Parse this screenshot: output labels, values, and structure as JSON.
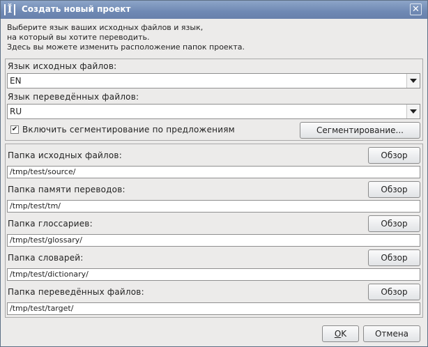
{
  "window": {
    "title": "Создать новый проект",
    "close_label": "✕"
  },
  "intro": {
    "lines": [
      "Выберите язык ваших исходных файлов и язык,",
      "на который вы хотите переводить.",
      "Здесь вы можете изменить расположение папок проекта."
    ]
  },
  "languages": {
    "source_label": "Язык исходных файлов:",
    "source_value": "EN",
    "target_label": "Язык переведённых файлов:",
    "target_value": "RU",
    "segmentation_checkbox_label": "Включить сегментирование по предложениям",
    "segmentation_checked": true,
    "segmentation_button": "Сегментирование..."
  },
  "folders": {
    "browse_label": "Обзор",
    "items": [
      {
        "label": "Папка исходных файлов:",
        "path": "/tmp/test/source/"
      },
      {
        "label": "Папка памяти переводов:",
        "path": "/tmp/test/tm/"
      },
      {
        "label": "Папка глоссариев:",
        "path": "/tmp/test/glossary/"
      },
      {
        "label": "Папка словарей:",
        "path": "/tmp/test/dictionary/"
      },
      {
        "label": "Папка переведённых файлов:",
        "path": "/tmp/test/target/"
      }
    ]
  },
  "footer": {
    "ok_mnemonic": "O",
    "ok_rest": "K",
    "cancel_label": "Отмена"
  }
}
